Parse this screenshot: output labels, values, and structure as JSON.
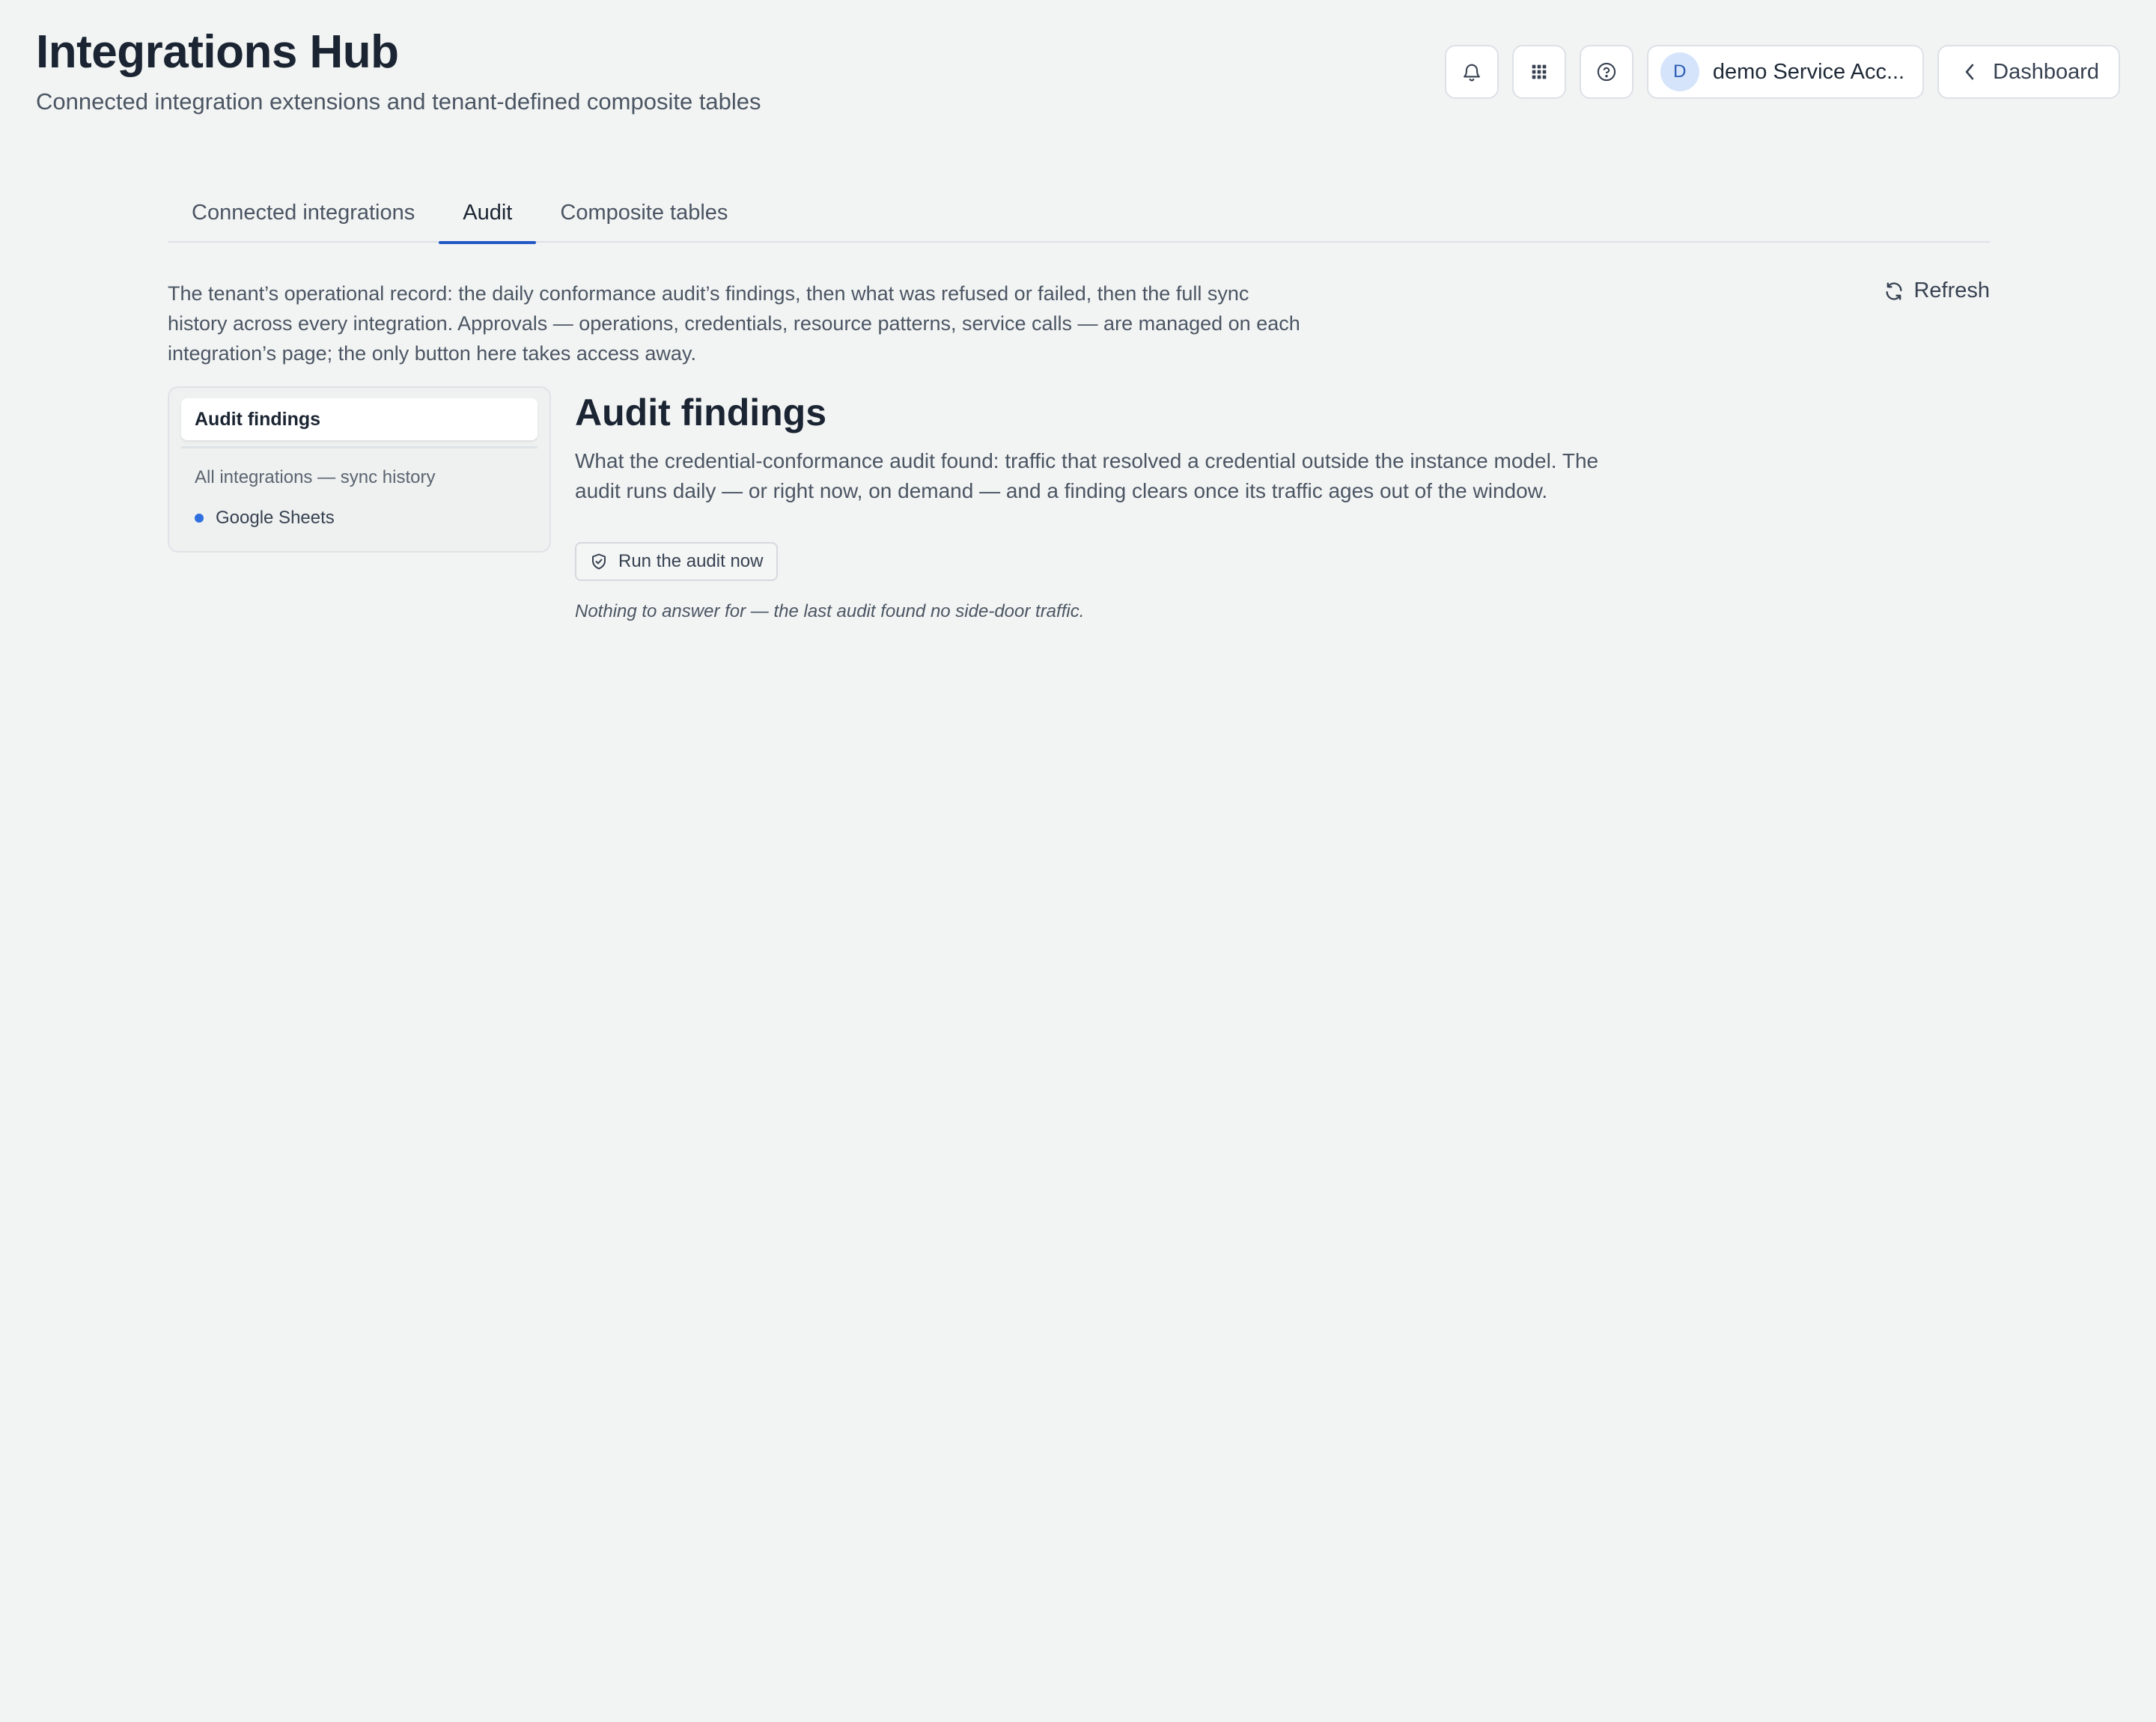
{
  "header": {
    "title": "Integrations Hub",
    "subtitle": "Connected integration extensions and tenant-defined composite tables",
    "icons": [
      "bell-icon",
      "apps-grid-icon",
      "help-icon"
    ],
    "account": {
      "initial": "D",
      "name": "demo Service Acc..."
    },
    "back_label": "Dashboard"
  },
  "tabs": [
    {
      "label": "Connected integrations",
      "active": false
    },
    {
      "label": "Audit",
      "active": true
    },
    {
      "label": "Composite tables",
      "active": false
    }
  ],
  "intro": "The tenant’s operational record: the daily conformance audit’s findings, then what was refused or failed, then the full sync history across every integration. Approvals — operations, credentials, resource patterns, service calls — are managed on each integration’s page; the only button here takes access away.",
  "refresh_label": "Refresh",
  "sidebar": {
    "active_label": "Audit findings",
    "link_label": "All integrations — sync history",
    "items": [
      {
        "label": "Google Sheets"
      }
    ]
  },
  "main": {
    "title": "Audit findings",
    "description": "What the credential-conformance audit found: traffic that resolved a credential outside the instance model. The audit runs daily — or right now, on demand — and a finding clears once its traffic ages out of the window.",
    "run_button_label": "Run the audit now",
    "empty_note": "Nothing to answer for — the last audit found no side-door traffic."
  },
  "colors": {
    "accent": "#2458c6",
    "background": "#f2f4f3",
    "status_dot": "#2f6fe0"
  }
}
